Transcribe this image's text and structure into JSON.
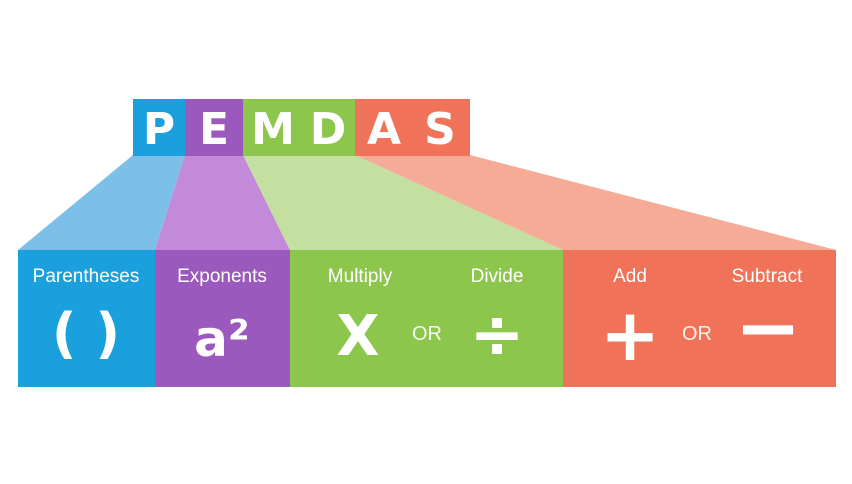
{
  "acronym": {
    "letters": [
      "P",
      "E",
      "M",
      "D",
      "A",
      "S"
    ]
  },
  "groups": {
    "parentheses": {
      "label": "Parentheses",
      "symbol": "( )"
    },
    "exponents": {
      "label": "Exponents",
      "symbol": "a²"
    },
    "multiply_divide": {
      "multiply_label": "Multiply",
      "multiply_symbol": "X",
      "or": "OR",
      "divide_label": "Divide",
      "divide_symbol": "÷"
    },
    "add_subtract": {
      "add_label": "Add",
      "add_symbol": "+",
      "or": "OR",
      "subtract_label": "Subtract",
      "subtract_symbol": "−"
    }
  },
  "colors": {
    "blue": "#1aa0dc",
    "blue_light": "#7cc0ea",
    "purple": "#9c59bd",
    "purple_light": "#c28ad8",
    "green": "#8dc64d",
    "green_light": "#c3e0a0",
    "orange": "#f07258",
    "orange_light": "#f6ab96"
  }
}
